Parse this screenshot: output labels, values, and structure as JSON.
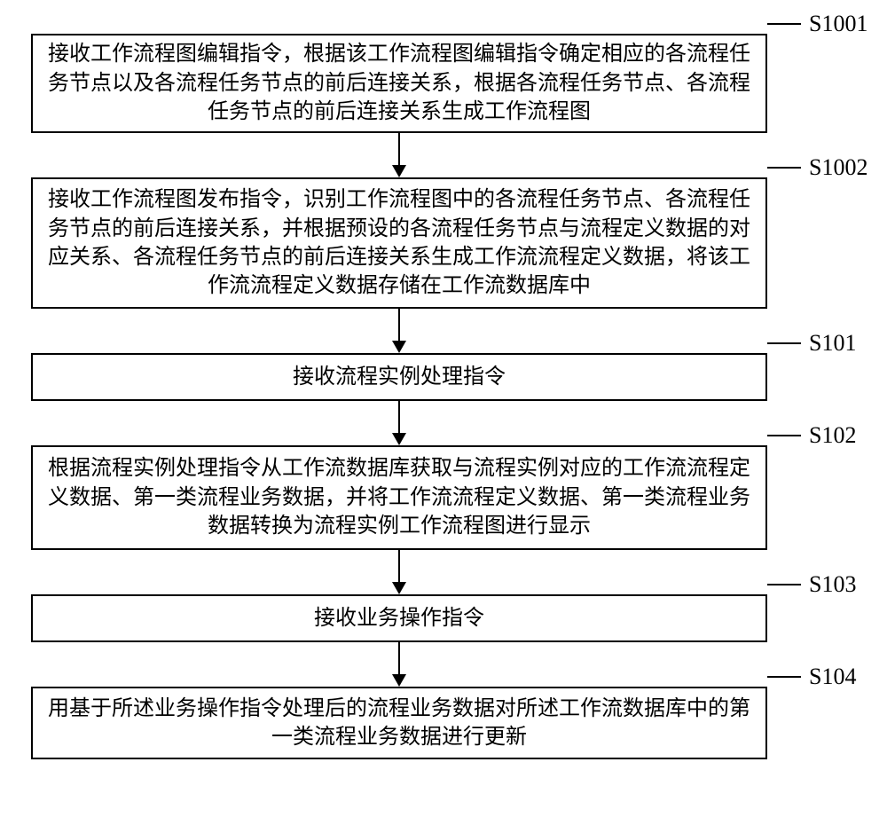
{
  "steps": [
    {
      "id": "S1001",
      "text": "接收工作流程图编辑指令，根据该工作流程图编辑指令确定相应的各流程任务节点以及各流程任务节点的前后连接关系，根据各流程任务节点、各流程任务节点的前后连接关系生成工作流程图"
    },
    {
      "id": "S1002",
      "text": "接收工作流程图发布指令，识别工作流程图中的各流程任务节点、各流程任务节点的前后连接关系，并根据预设的各流程任务节点与流程定义数据的对应关系、各流程任务节点的前后连接关系生成工作流流程定义数据，将该工作流流程定义数据存储在工作流数据库中"
    },
    {
      "id": "S101",
      "text": "接收流程实例处理指令"
    },
    {
      "id": "S102",
      "text": "根据流程实例处理指令从工作流数据库获取与流程实例对应的工作流流程定义数据、第一类流程业务数据，并将工作流流程定义数据、第一类流程业务数据转换为流程实例工作流程图进行显示"
    },
    {
      "id": "S103",
      "text": "接收业务操作指令"
    },
    {
      "id": "S104",
      "text": "用基于所述业务操作指令处理后的流程业务数据对所述工作流数据库中的第一类流程业务数据进行更新"
    }
  ]
}
